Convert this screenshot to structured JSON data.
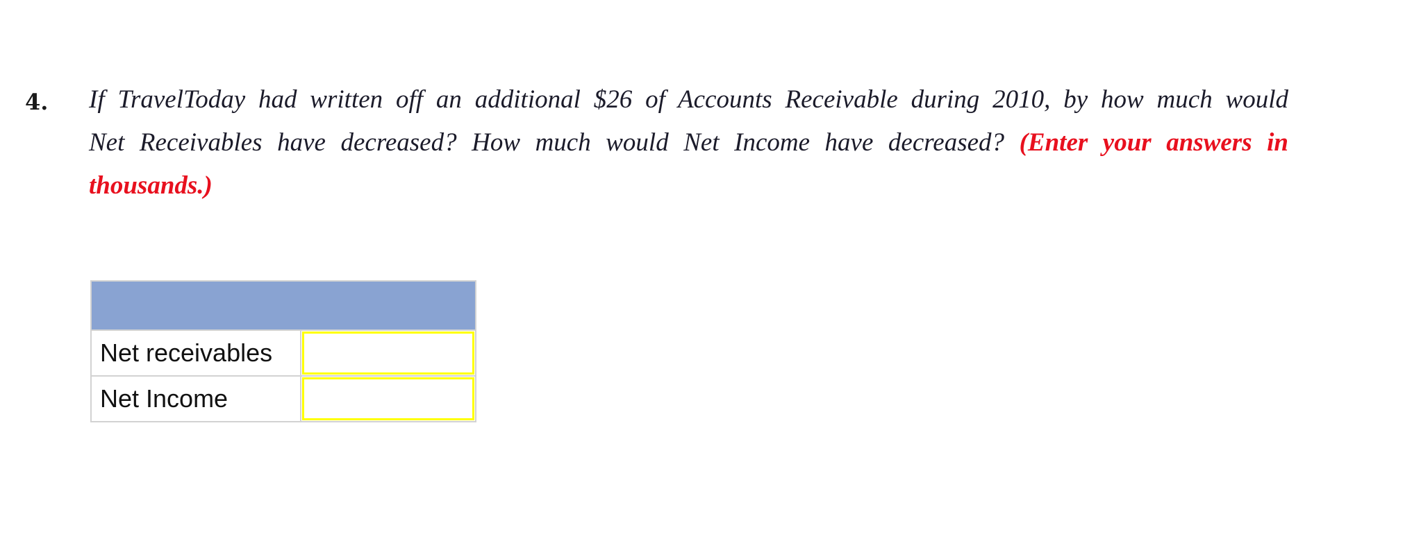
{
  "question": {
    "number": "4.",
    "lines": [
      {
        "text": "If TravelToday had written off an additional $26 of Accounts Receivable during 2010, by how much would",
        "emphasis": ""
      },
      {
        "text": "Net Receivables have decreased? How much would Net Income have decreased? ",
        "emphasis": "(Enter your answers in"
      },
      {
        "text": "",
        "emphasis": "thousands.)"
      }
    ],
    "emphasis_color": "#e8101e"
  },
  "answer_table": {
    "header_color": "#89a3d2",
    "input_border_color": "#ffff00",
    "rows": [
      {
        "label": "Net receivables",
        "value": ""
      },
      {
        "label": "Net Income",
        "value": ""
      }
    ]
  }
}
